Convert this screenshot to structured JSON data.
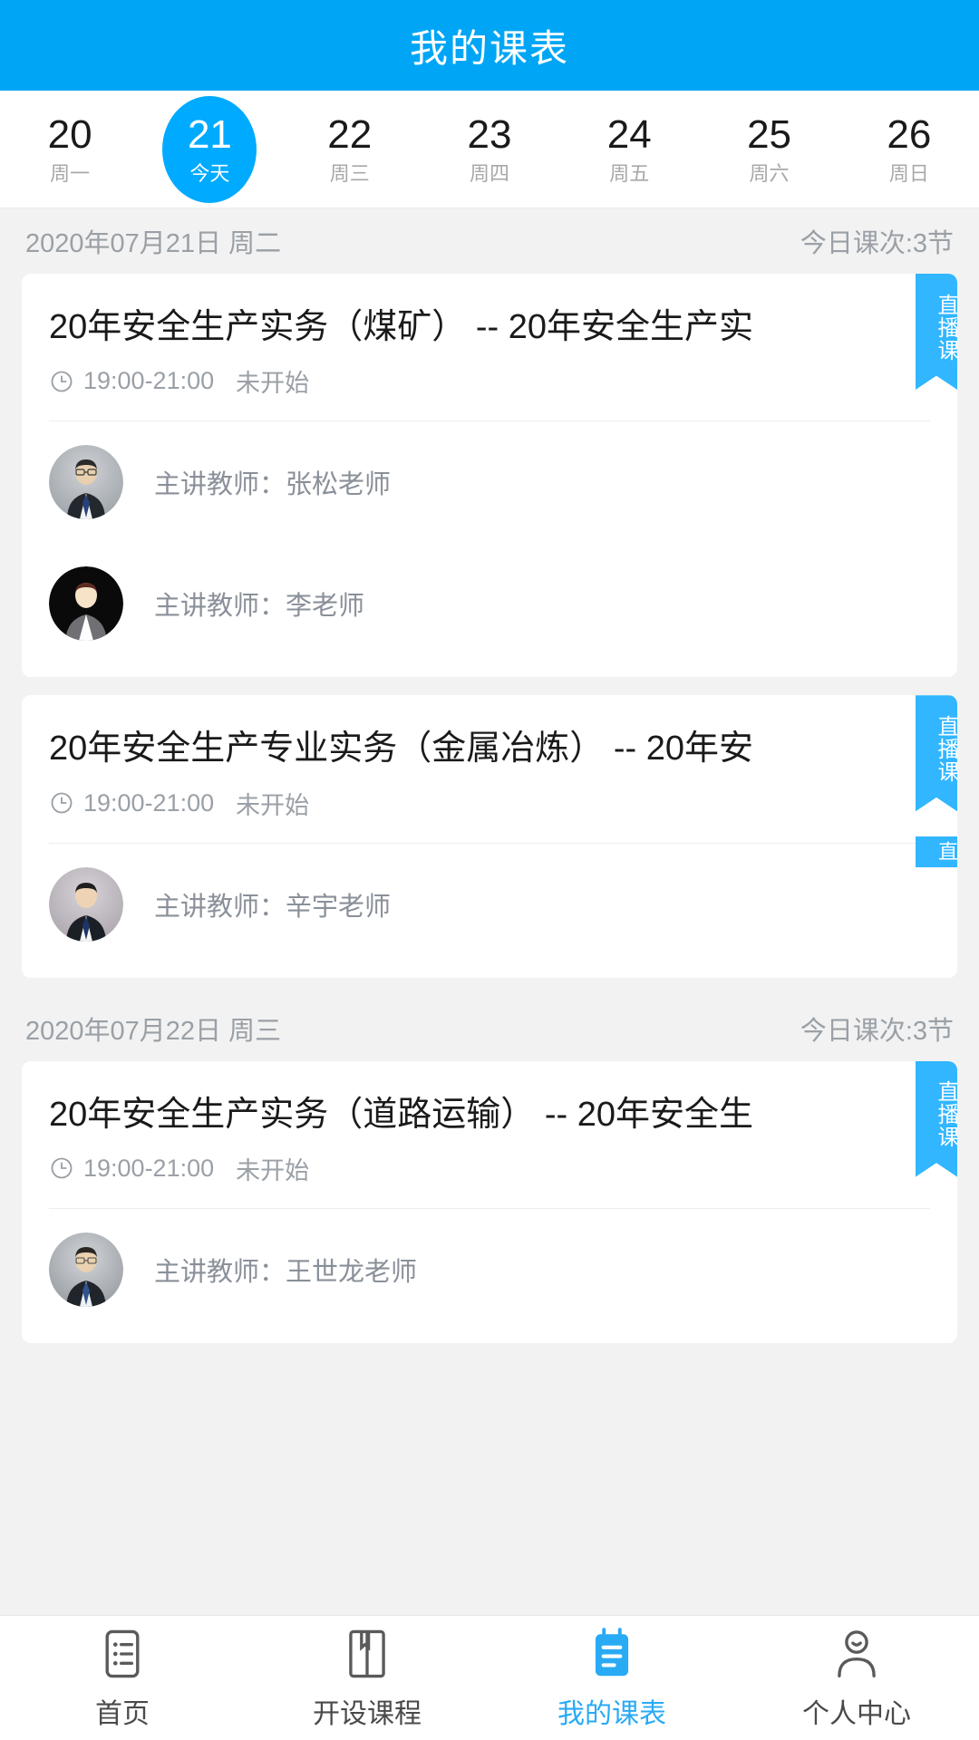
{
  "header": {
    "title": "我的课表"
  },
  "week_strip": {
    "days": [
      {
        "num": "20",
        "label": "周一",
        "active": false
      },
      {
        "num": "21",
        "label": "今天",
        "active": true
      },
      {
        "num": "22",
        "label": "周三",
        "active": false
      },
      {
        "num": "23",
        "label": "周四",
        "active": false
      },
      {
        "num": "24",
        "label": "周五",
        "active": false
      },
      {
        "num": "25",
        "label": "周六",
        "active": false
      },
      {
        "num": "26",
        "label": "周日",
        "active": false
      }
    ]
  },
  "groups": [
    {
      "date": "2020年07月21日 周二",
      "count": "今日课次:3节",
      "cards": [
        {
          "title": "20年安全生产实务（煤矿） -- 20年安全生产实",
          "time": "19:00-21:00",
          "status": "未开始",
          "badge": "直播课",
          "teachers": [
            {
              "name": "主讲教师：张松老师"
            },
            {
              "name": "主讲教师：李老师"
            }
          ]
        },
        {
          "title": "20年安全生产专业实务（金属冶炼） -- 20年安",
          "time": "19:00-21:00",
          "status": "未开始",
          "badge": "直播课",
          "teachers": [
            {
              "name": "主讲教师：辛宇老师"
            }
          ]
        }
      ]
    },
    {
      "date": "2020年07月22日 周三",
      "count": "今日课次:3节",
      "cards": [
        {
          "title": "20年安全生产实务（道路运输） -- 20年安全生",
          "time": "19:00-21:00",
          "status": "未开始",
          "badge": "直播课",
          "teachers": [
            {
              "name": "主讲教师：王世龙老师"
            }
          ]
        }
      ]
    }
  ],
  "partial_badge": {
    "text": "直"
  },
  "tabbar": {
    "items": [
      {
        "label": "首页",
        "icon": "list-icon",
        "active": false
      },
      {
        "label": "开设课程",
        "icon": "book-icon",
        "active": false
      },
      {
        "label": "我的课表",
        "icon": "notebook-icon",
        "active": true
      },
      {
        "label": "个人中心",
        "icon": "person-icon",
        "active": false
      }
    ]
  },
  "colors": {
    "brand": "#00a6f5",
    "accent": "#00aaff",
    "badge": "#31b6ff",
    "muted": "#9aa0a6",
    "page_bg": "#f2f2f2"
  }
}
